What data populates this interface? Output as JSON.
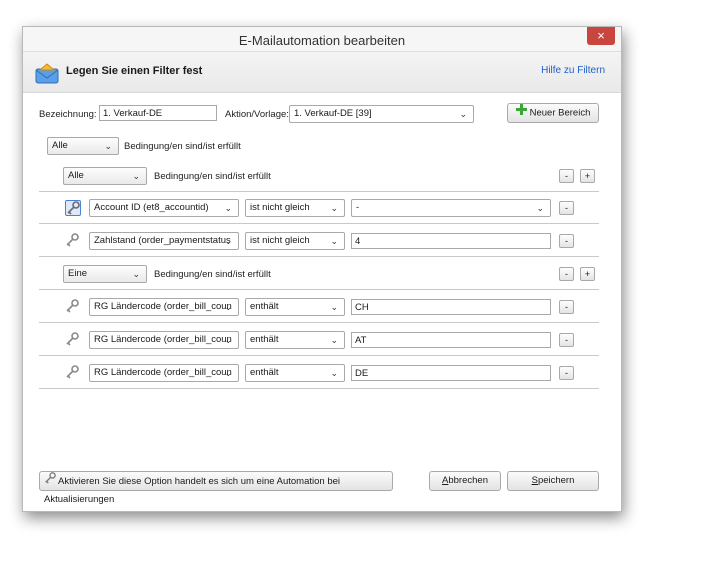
{
  "window": {
    "title": "E-Mailautomation bearbeiten",
    "close": "×"
  },
  "header": {
    "text": "Legen Sie einen Filter fest",
    "help_link": "Hilfe zu Filtern"
  },
  "form": {
    "bezeichnung_label": "Bezeichnung:",
    "bezeichnung_value": "1. Verkauf-DE",
    "aktion_label": "Aktion/Vorlage:",
    "aktion_value": "1. Verkauf-DE [39]",
    "neuer_bereich": "Neuer Bereich"
  },
  "top_condition": {
    "mode": "Alle",
    "text": "Bedingung/en sind/ist erfüllt"
  },
  "groups": [
    {
      "mode": "Alle",
      "text": "Bedingung/en sind/ist erfüllt",
      "rows": [
        {
          "field": "Account ID (et8_accountid)",
          "op": "ist nicht gleich",
          "value": "-",
          "value_is_select": true
        },
        {
          "field": "Zahlstand (order_paymentstatus",
          "op": "ist nicht gleich",
          "value": "4",
          "value_is_select": false
        }
      ]
    },
    {
      "mode": "Eine",
      "text": "Bedingung/en sind/ist erfüllt",
      "rows": [
        {
          "field": "RG Ländercode (order_bill_coun",
          "op": "enthält",
          "value": "CH",
          "value_is_select": false
        },
        {
          "field": "RG Ländercode (order_bill_coun",
          "op": "enthält",
          "value": "AT",
          "value_is_select": false
        },
        {
          "field": "RG Ländercode (order_bill_coun",
          "op": "enthält",
          "value": "DE",
          "value_is_select": false
        }
      ]
    }
  ],
  "footer": {
    "hint": "Aktivieren Sie diese Option handelt es sich um eine Automation bei Aktualisierungen",
    "cancel_first": "A",
    "cancel_rest": "bbrechen",
    "save_first": "S",
    "save_rest": "peichern"
  },
  "colors": {
    "link": "#1f5fc9",
    "close": "#c8463d",
    "plus_icon": "#3aa63a"
  }
}
